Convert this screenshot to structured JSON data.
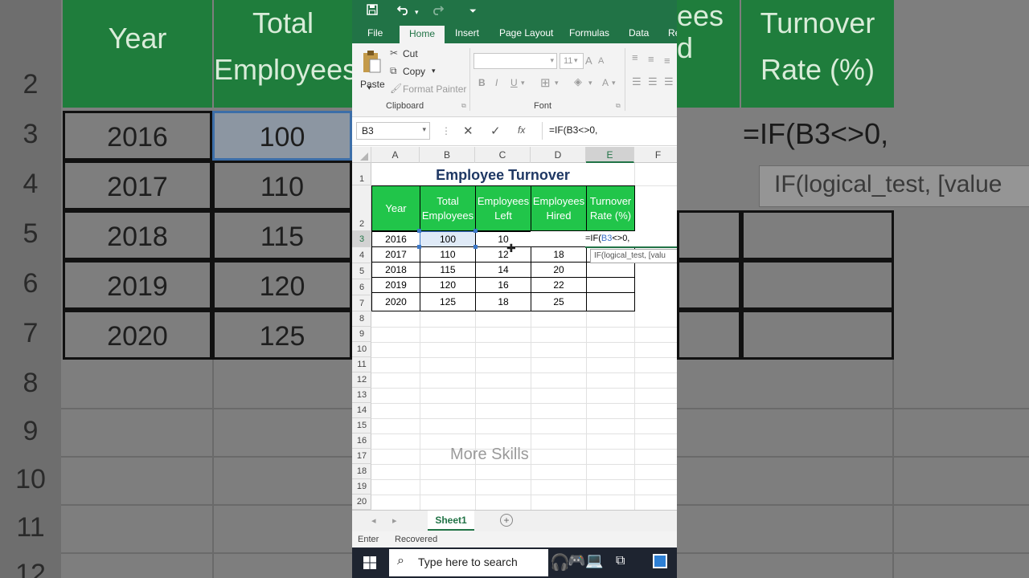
{
  "background": {
    "row_numbers": [
      "2",
      "3",
      "4",
      "5",
      "6",
      "7",
      "8",
      "9",
      "10",
      "11",
      "12"
    ],
    "header_year": "Year",
    "header_total": "Total Employees",
    "header_right": "ees",
    "header_right2": "d",
    "header_turnover": "Turnover Rate (%)",
    "years": [
      "2016",
      "2017",
      "2018",
      "2019",
      "2020"
    ],
    "totals": [
      "100",
      "110",
      "115",
      "120",
      "125"
    ],
    "formula": "=IF(B3<>0,",
    "tooltip": "IF(logical_test, [value"
  },
  "app": {
    "quick_access": {
      "save_icon": "save-icon",
      "undo_icon": "undo-icon",
      "redo_icon": "redo-icon"
    },
    "tabs": [
      "File",
      "Home",
      "Insert",
      "Page Layout",
      "Formulas",
      "Data",
      "Re"
    ],
    "active_tab": "Home",
    "clipboard": {
      "paste": "Paste",
      "cut": "Cut",
      "copy": "Copy",
      "format_painter": "Format Painter",
      "group": "Clipboard"
    },
    "font": {
      "size": "11",
      "group": "Font",
      "bold": "B",
      "italic": "I",
      "underline": "U",
      "grow": "A",
      "shrink": "A"
    },
    "name_box": "B3",
    "formula_input": "=IF(B3<>0,",
    "columns": [
      "A",
      "B",
      "C",
      "D",
      "E",
      "F"
    ],
    "rows": [
      "1",
      "2",
      "3",
      "4",
      "5",
      "6",
      "7",
      "8",
      "9",
      "10",
      "11",
      "12",
      "13",
      "14",
      "15",
      "16",
      "17",
      "18",
      "19",
      "20"
    ],
    "title": "Employee Turnover",
    "headers": [
      "Year",
      "Total Employees",
      "Employees Left",
      "Employees Hired",
      "Turnover Rate (%)"
    ],
    "table": [
      [
        "2016",
        "100",
        "10",
        ""
      ],
      [
        "2017",
        "110",
        "12",
        "18"
      ],
      [
        "2018",
        "115",
        "14",
        "20"
      ],
      [
        "2019",
        "120",
        "16",
        "22"
      ],
      [
        "2020",
        "125",
        "18",
        "25"
      ]
    ],
    "cell_formula": {
      "prefix": "=IF(",
      "ref": "B3",
      "suffix": "<>0,"
    },
    "cell_tooltip": "IF(logical_test, [valu",
    "watermark": "More Skills",
    "sheet_tab": "Sheet1",
    "status": {
      "mode": "Enter",
      "state": "Recovered"
    },
    "taskbar": {
      "search_placeholder": "Type here to search"
    },
    "accent": "#217346",
    "header_fill": "#21c54a"
  }
}
